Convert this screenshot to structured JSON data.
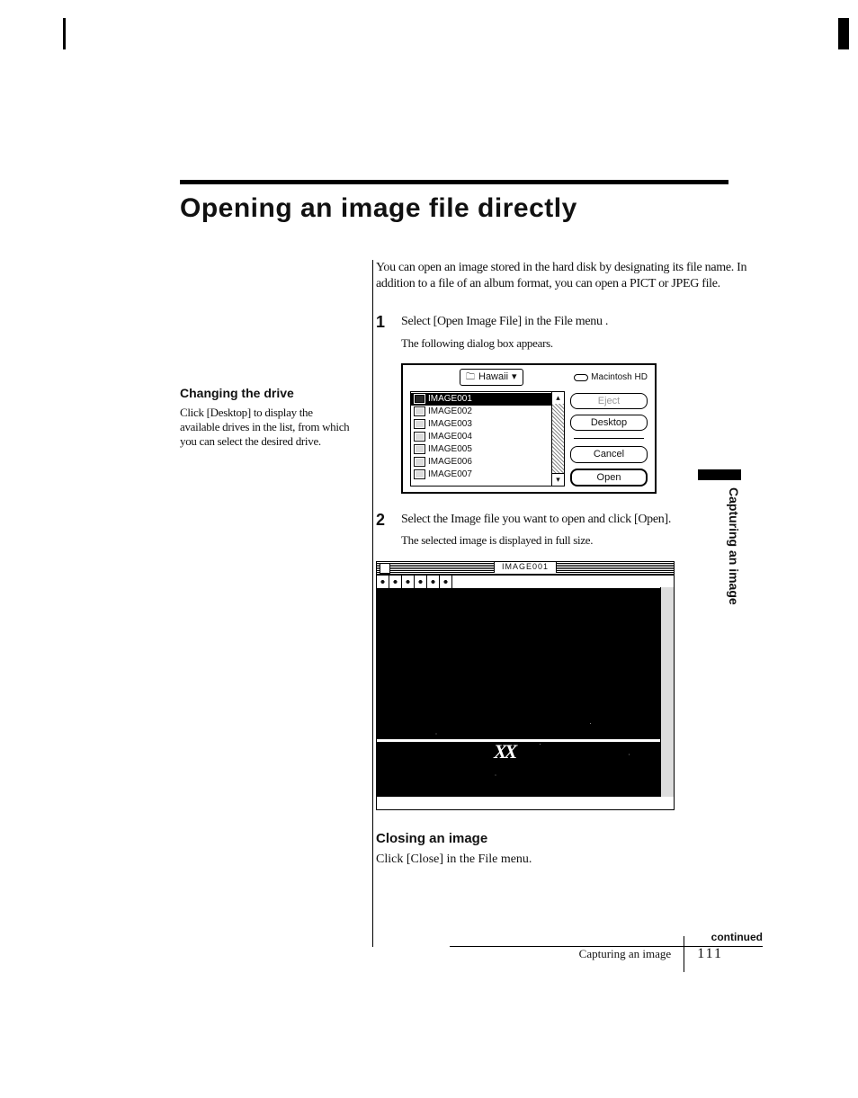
{
  "page": {
    "title": "Opening an image file directly",
    "section_tab": "Capturing an image",
    "footer_section": "Capturing an image",
    "page_number": "111",
    "continued": "continued"
  },
  "intro": {
    "text": "You can open an image stored in the hard disk by designating its file name. In addition to a file of an album format, you can open a PICT or JPEG file."
  },
  "sidebar": {
    "heading": "Changing the drive",
    "text": "Click [Desktop] to display the available drives in the list, from which you can select the desired drive."
  },
  "steps": [
    {
      "num": "1",
      "text": "Select [Open Image File] in the File menu .",
      "sub": "The following dialog box appears."
    },
    {
      "num": "2",
      "text": "Select the Image file you want to open and click [Open].",
      "sub": "The selected image is displayed in full size."
    }
  ],
  "dialog": {
    "folder_name": "Hawaii",
    "disk_name": "Macintosh HD",
    "files": [
      "IMAGE001",
      "IMAGE002",
      "IMAGE003",
      "IMAGE004",
      "IMAGE005",
      "IMAGE006",
      "IMAGE007"
    ],
    "buttons": {
      "eject": "Eject",
      "desktop": "Desktop",
      "cancel": "Cancel",
      "open": "Open"
    }
  },
  "window": {
    "title": "IMAGE001"
  },
  "closing": {
    "heading": "Closing an image",
    "text": "Click [Close] in the File menu."
  }
}
